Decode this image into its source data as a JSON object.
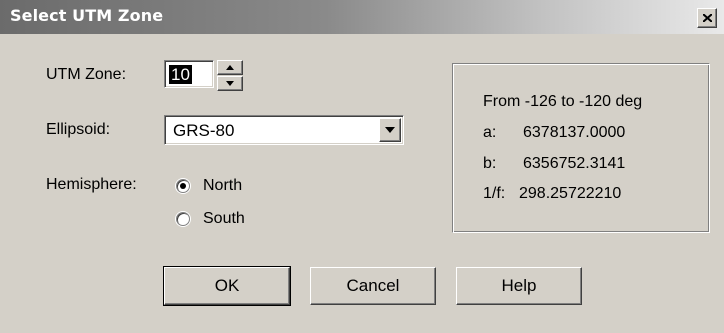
{
  "window": {
    "title": "Select UTM Zone"
  },
  "form": {
    "zone_label": "UTM Zone:",
    "zone_value": "10",
    "ellipsoid_label": "Ellipsoid:",
    "ellipsoid_value": "GRS-80",
    "hemisphere_label": "Hemisphere:",
    "hemisphere_options": [
      {
        "label": "North",
        "selected": true
      },
      {
        "label": "South",
        "selected": false
      }
    ]
  },
  "info": {
    "range": "From -126 to -120 deg",
    "a_key": "a:",
    "a_value": "6378137.0000",
    "b_key": "b:",
    "b_value": "6356752.3141",
    "f_key": "1/f:",
    "f_value": "298.25722210"
  },
  "buttons": {
    "ok": "OK",
    "cancel": "Cancel",
    "help": "Help"
  },
  "icons": [
    "close-icon",
    "spin-up-arrow-icon",
    "spin-down-arrow-icon",
    "dropdown-arrow-icon"
  ]
}
